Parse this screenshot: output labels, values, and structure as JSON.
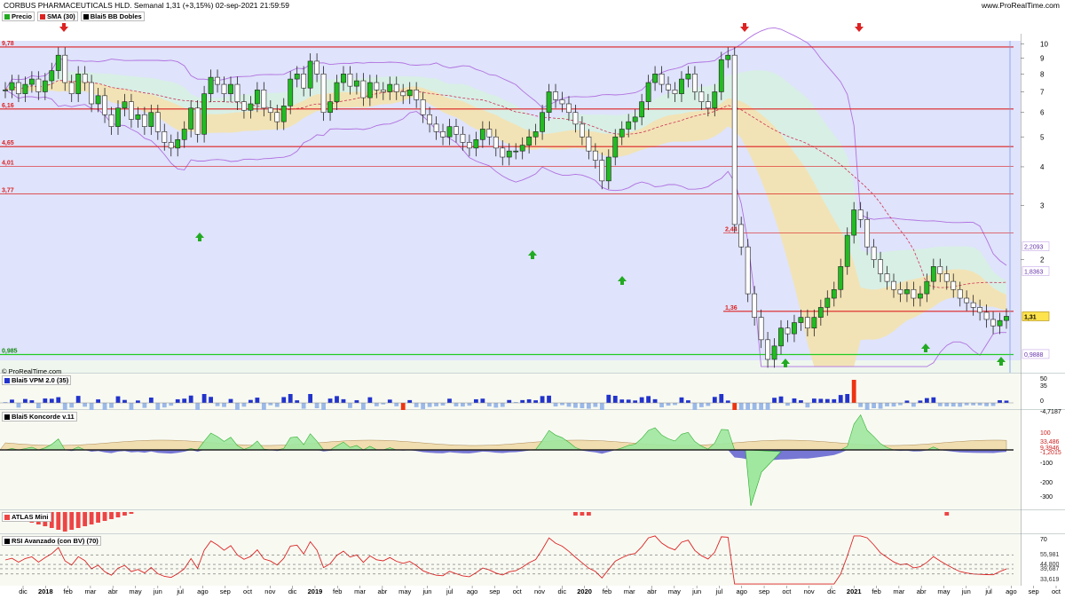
{
  "header": {
    "title": "CORBUS PHARMACEUTICALS HLD. Semanal 1,31 (+3,15%) 02-sep-2021 21:59:59",
    "site": "www.ProRealTime.com"
  },
  "legend": [
    {
      "label": "Precio",
      "color": "#22aa22"
    },
    {
      "label": "SMA (30)",
      "color": "#dd2222"
    },
    {
      "label": "Blai5 BB Dobles",
      "color": "#000000"
    }
  ],
  "watermark": "© ProRealTime.com",
  "colors": {
    "background": "#ffffff",
    "price_panel_bg": "#dfe3fb",
    "level_line": "#dd2222",
    "support_line": "#22cc22",
    "up_candle": "#22bb22",
    "down_candle": "#ffffff",
    "bb_outer": "#b070e0",
    "inner_band_fill": "#f3e2b3",
    "inner_band_fill_alt": "#d7efe3",
    "sma": "#cc3355",
    "arrow_up": "#22aa22",
    "arrow_down": "#dd2222",
    "vpm_pos": "#2233cc",
    "vpm_neg": "#9ab8e8",
    "vpm_alert": "#ee3311",
    "koncorde_green": "#a0e8a0",
    "koncorde_brown": "#f0ddb0",
    "koncorde_blue": "#5555cc",
    "atlas_red": "#ee4444",
    "rsi_line": "#dd2222",
    "rsi_fill_green": "#66dd66",
    "rsi_fill_red": "#ee6666"
  },
  "chart_data": [
    {
      "type": "candlestick",
      "title": "CORBUS PHARMACEUTICALS HLD. Semanal",
      "yscale": "log",
      "ylim": [
        0.86,
        10.8
      ],
      "y_ticks": [
        10,
        9,
        8,
        7,
        6,
        5,
        4,
        3,
        2
      ],
      "x_ticks": [
        "dic",
        "2018",
        "feb",
        "mar",
        "abr",
        "may",
        "jun",
        "jul",
        "ago",
        "sep",
        "oct",
        "nov",
        "dic",
        "2019",
        "feb",
        "mar",
        "abr",
        "may",
        "jun",
        "jul",
        "ago",
        "sep",
        "oct",
        "nov",
        "dic",
        "2020",
        "feb",
        "mar",
        "abr",
        "may",
        "jun",
        "jul",
        "ago",
        "sep",
        "oct",
        "nov",
        "dic",
        "2021",
        "feb",
        "mar",
        "abr",
        "may",
        "jun",
        "jul",
        "ago",
        "sep",
        "oct"
      ],
      "levels": [
        {
          "label": "9,78",
          "value": 9.78
        },
        {
          "label": "6,16",
          "value": 6.16
        },
        {
          "label": "4,65",
          "value": 4.65
        },
        {
          "label": "4,01",
          "value": 4.01
        },
        {
          "label": "3,77",
          "value": 3.27
        },
        {
          "label": "2,44",
          "value": 2.44
        },
        {
          "label": "1,36",
          "value": 1.36
        }
      ],
      "support": {
        "label": "0,985",
        "value": 0.985
      },
      "right_labels": [
        {
          "label": "2,2093",
          "value": 2.2093
        },
        {
          "label": "1,8363",
          "value": 1.8363
        },
        {
          "label": "1,31",
          "value": 1.31
        },
        {
          "label": "0,9888",
          "value": 0.9888
        }
      ],
      "close_label": "1,31",
      "close": [
        7.1,
        7.5,
        6.9,
        7.4,
        7.7,
        7.0,
        7.6,
        8.2,
        9.2,
        7.5,
        6.9,
        8.0,
        7.5,
        6.4,
        6.8,
        5.9,
        5.4,
        6.2,
        6.5,
        5.7,
        5.9,
        5.4,
        6.0,
        5.2,
        4.8,
        4.6,
        4.9,
        5.3,
        6.2,
        5.1,
        6.9,
        7.8,
        7.4,
        6.9,
        7.4,
        6.5,
        6.1,
        6.4,
        7.1,
        6.2,
        6.0,
        5.6,
        6.3,
        7.7,
        8.0,
        7.2,
        8.8,
        8.0,
        6.0,
        6.5,
        7.5,
        8.0,
        7.3,
        7.6,
        6.7,
        7.5,
        7.1,
        7.0,
        7.4,
        7.0,
        6.8,
        7.1,
        6.6,
        5.9,
        5.5,
        5.2,
        5.0,
        5.4,
        5.1,
        4.8,
        4.6,
        4.9,
        5.3,
        5.0,
        4.6,
        4.3,
        4.5,
        4.5,
        4.7,
        5.0,
        5.2,
        6.0,
        7.0,
        6.6,
        6.4,
        6.0,
        5.5,
        5.0,
        4.5,
        4.2,
        3.6,
        4.3,
        5.0,
        5.3,
        5.6,
        5.8,
        6.5,
        7.5,
        8.0,
        7.4,
        7.1,
        6.9,
        7.7,
        8.0,
        7.0,
        6.5,
        6.2,
        7.0,
        8.9,
        9.2,
        2.6,
        2.2,
        1.55,
        1.3,
        1.1,
        0.95,
        1.05,
        1.2,
        1.15,
        1.25,
        1.3,
        1.2,
        1.3,
        1.4,
        1.5,
        1.6,
        1.9,
        2.4,
        2.9,
        2.7,
        2.2,
        2.0,
        1.8,
        1.7,
        1.6,
        1.55,
        1.6,
        1.5,
        1.55,
        1.7,
        1.9,
        1.8,
        1.7,
        1.6,
        1.5,
        1.45,
        1.4,
        1.35,
        1.28,
        1.22,
        1.27,
        1.31
      ],
      "sma_label": "SMA (30)",
      "panels": [
        {
          "title": "Blai5 VPM 2.0 (35)",
          "ticks": [
            "50",
            "35",
            "0",
            "-4,7187"
          ]
        },
        {
          "title": "Blai5 Koncorde v.11",
          "ticks": [
            "100",
            "33,486",
            "9,3946",
            "-1,2015",
            "-100",
            "-200",
            "-300"
          ]
        },
        {
          "title": "ATLAS Mini",
          "ticks": []
        },
        {
          "title": "RSI Avanzado (con BV) (70)",
          "ticks": [
            "70",
            "55,981",
            "44,800",
            "39,687",
            "33,619"
          ]
        }
      ]
    }
  ]
}
